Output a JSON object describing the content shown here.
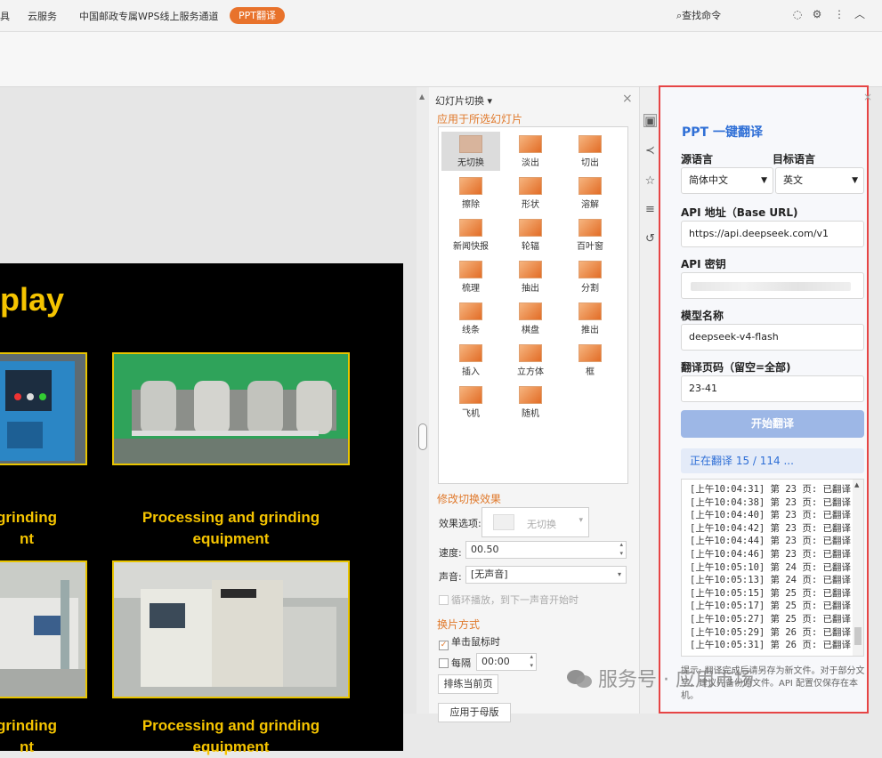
{
  "topbar": {
    "menus": [
      "具",
      "云服务",
      "中国邮政专属WPS线上服务通道"
    ],
    "ppt_translate_label": "PPT翻译",
    "find_command": "查找命令"
  },
  "slide": {
    "title": "play",
    "captions": [
      {
        "line1": "grinding",
        "line2": "nt"
      },
      {
        "line1": "Processing and grinding",
        "line2": "equipment"
      },
      {
        "line1": "grinding",
        "line2": "nt"
      },
      {
        "line1": "Processing and grinding",
        "line2": "equipment"
      }
    ]
  },
  "transition_pane": {
    "header": "幻灯片切换 ▾",
    "apply_section": "应用于所选幻灯片",
    "items": [
      "无切换",
      "淡出",
      "切出",
      "擦除",
      "形状",
      "溶解",
      "新闻快报",
      "轮辐",
      "百叶窗",
      "梳理",
      "抽出",
      "分割",
      "线条",
      "棋盘",
      "推出",
      "插入",
      "立方体",
      "框",
      "飞机",
      "随机"
    ],
    "modify_section": "修改切换效果",
    "effect_label": "效果选项:",
    "effect_value": "无切换",
    "speed_label": "速度:",
    "speed_value": "00.50",
    "sound_label": "声音:",
    "sound_value": "[无声音]",
    "loop_label": "循环播放，到下一声音开始时",
    "advance_section": "换片方式",
    "on_click_label": "单击鼠标时",
    "every_label": "每隔",
    "every_value": "00:00",
    "rehearse_button": "排练当前页",
    "apply_all_button": "应用于母版"
  },
  "translator": {
    "title": "PPT 一键翻译",
    "source_lang_label": "源语言",
    "target_lang_label": "目标语言",
    "source_lang_value": "简体中文",
    "target_lang_value": "英文",
    "api_url_label": "API 地址（Base URL)",
    "api_url_value": "https://api.deepseek.com/v1",
    "api_key_label": "API 密钥",
    "model_label": "模型名称",
    "model_value": "deepseek-v4-flash",
    "pages_label": "翻译页码（留空=全部)",
    "pages_value": "23-41",
    "start_button": "开始翻译",
    "progress_text": "正在翻译 15 / 114 ...",
    "log_lines": [
      "[上午10:04:31] 第 23 页: 已翻译",
      "[上午10:04:38] 第 23 页: 已翻译",
      "[上午10:04:40] 第 23 页: 已翻译",
      "[上午10:04:42] 第 23 页: 已翻译",
      "[上午10:04:44] 第 23 页: 已翻译",
      "[上午10:04:46] 第 23 页: 已翻译",
      "[上午10:05:10] 第 24 页: 已翻译",
      "[上午10:05:13] 第 24 页: 已翻译",
      "[上午10:05:15] 第 25 页: 已翻译",
      "[上午10:05:17] 第 25 页: 已翻译",
      "[上午10:05:27] 第 25 页: 已翻译",
      "[上午10:05:29] 第 26 页: 已翻译",
      "[上午10:05:31] 第 26 页: 已翻译"
    ],
    "tip": "提示: 翻译完成后请另存为新文件。对于部分文字，建议先备份原文件。API 配置仅保存在本机。"
  },
  "watermark": "服务号 · 应用市场",
  "colors": {
    "accent": "#e8722b",
    "plugin_blue": "#2f6fd6",
    "highlight_border": "#e64545",
    "slide_text": "#f5c400"
  }
}
